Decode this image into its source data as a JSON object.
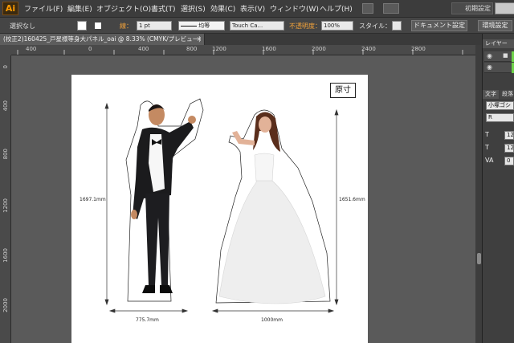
{
  "app": {
    "logo": "Ai",
    "menu": [
      "ファイル(F)",
      "編集(E)",
      "オブジェクト(O)",
      "書式(T)",
      "選択(S)",
      "効果(C)",
      "表示(V)",
      "ウィンドウ(W)",
      "ヘルプ(H)"
    ],
    "workspace": "初期設定"
  },
  "control_bar": {
    "selection": "選択なし",
    "stroke_label": "線：",
    "stroke_weight": "1 pt",
    "profile": "均等",
    "brush": "Touch Ca...",
    "opacity_label": "不透明度：",
    "opacity_value": "100%",
    "style_label": "スタイル：",
    "document_setup_button": "ドキュメント設定",
    "preferences_button": "環境設定"
  },
  "document_tab": {
    "title": "(校正2)160425_戸星様等身大パネル_oai @ 8.33% (CMYK/プレビュー)"
  },
  "ruler": {
    "horizontal": [
      "400",
      "0",
      "400",
      "800",
      "1200",
      "1600",
      "2000",
      "2400",
      "2800"
    ],
    "vertical": [
      "0",
      "400",
      "800",
      "1200",
      "1600",
      "2000"
    ]
  },
  "artboard": {
    "original_size_label": "原寸",
    "dimensions": {
      "groom_height": "1697.1mm",
      "groom_width": "775.7mm",
      "bride_height": "1651.6mm",
      "bride_width": "1000mm"
    }
  },
  "panels": {
    "layers_tab": "レイヤー",
    "character_tab": "文字",
    "paragraph_tab": "段落",
    "font_family": "小塚ゴシ",
    "font_style": "R",
    "font_size": "12",
    "leading": "12",
    "tracking": "0"
  },
  "colors": {
    "accent": "#ff9a00",
    "layer_color": "#6fd34a"
  }
}
